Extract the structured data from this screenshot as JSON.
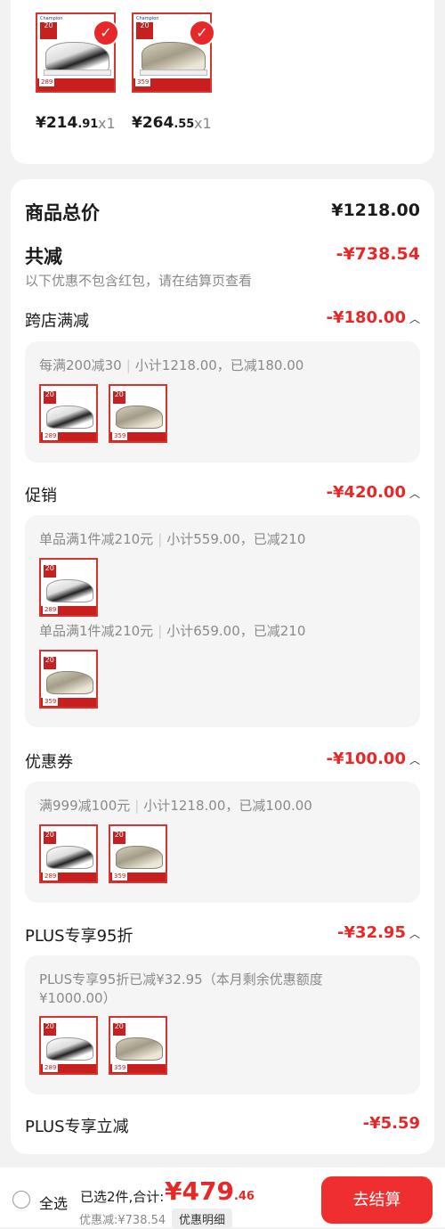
{
  "selected_items": [
    {
      "price_main": "¥214",
      "price_cents": ".91",
      "qty": "x1",
      "kind": "white"
    },
    {
      "price_main": "¥264",
      "price_cents": ".55",
      "qty": "x1",
      "kind": "grey"
    }
  ],
  "summary": {
    "total_label": "商品总价",
    "total_value": "¥1218.00",
    "discount_label": "共减",
    "discount_value": "-¥738.54",
    "discount_note": "以下优惠不包含红包，请在结算页查看"
  },
  "sections": [
    {
      "title": "跨店满减",
      "amount": "-¥180.00",
      "lines": [
        {
          "rule": "每满200减30",
          "detail": "小计1218.00，已减180.00"
        }
      ]
    },
    {
      "title": "促销",
      "amount": "-¥420.00",
      "lines": [
        {
          "rule": "单品满1件减210元",
          "detail": "小计559.00，已减210"
        },
        {
          "rule": "单品满1件减210元",
          "detail": "小计659.00，已减210"
        }
      ]
    },
    {
      "title": "优惠券",
      "amount": "-¥100.00",
      "lines": [
        {
          "rule": "满999减100元",
          "detail": "小计1218.00，已减100.00"
        }
      ]
    },
    {
      "title": "PLUS专享95折",
      "amount": "-¥32.95",
      "lines": [
        {
          "rule": "PLUS专享95折已减¥32.95（本月剩余优惠额度",
          "detail": "¥1000.00）"
        }
      ]
    },
    {
      "title": "PLUS专享立减",
      "amount": "-¥5.59"
    }
  ],
  "thumb": {
    "brand": "Champion",
    "tag": "20",
    "white_price": "289",
    "grey_price": "359"
  },
  "bottom_bar": {
    "select_all": "全选",
    "selected_text": "已选2件,合计:",
    "total_main": "¥479",
    "total_cents": ".46",
    "saved_text": "优惠减:¥738.54",
    "detail_button": "优惠明细",
    "checkout_button": "去结算"
  },
  "icons": {
    "check": "check-icon",
    "chevron": "chevron-up-icon",
    "radio": "radio-unchecked-icon"
  },
  "colors": {
    "accent": "#e62828",
    "button": "#ef2f2f"
  }
}
